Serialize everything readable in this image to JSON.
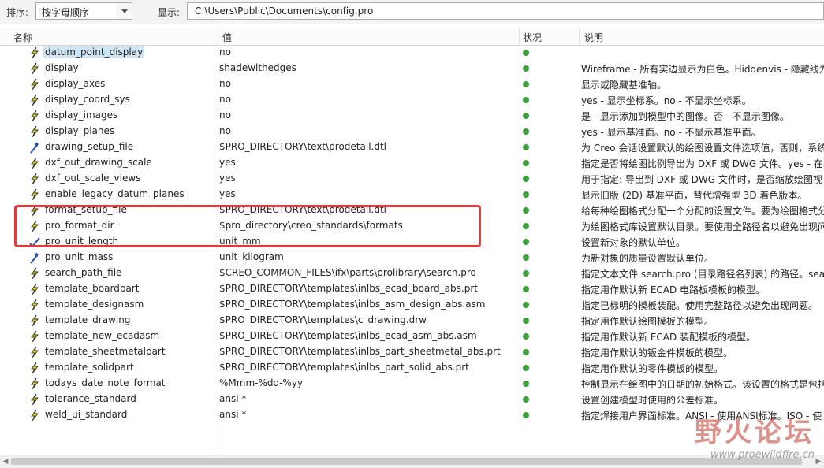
{
  "toolbar": {
    "sort_label": "排序:",
    "sort_value": "按字母顺序",
    "show_label": "显示:",
    "path_value": "C:\\Users\\Public\\Documents\\config.pro"
  },
  "columns": {
    "name": "名称",
    "value": "值",
    "status": "状况",
    "desc": "说明"
  },
  "rows": [
    {
      "name": "datum_point_display",
      "value": "no",
      "desc": "",
      "icon": "lightning-icon"
    },
    {
      "name": "display",
      "value": "shadewithedges",
      "desc": "Wireframe - 所有实边显示为白色。Hiddenvis - 隐藏线为",
      "icon": "lightning-icon"
    },
    {
      "name": "display_axes",
      "value": "no",
      "desc": "显示或隐藏基准轴。",
      "icon": "lightning-icon"
    },
    {
      "name": "display_coord_sys",
      "value": "no",
      "desc": "yes - 显示坐标系。no - 不显示坐标系。",
      "icon": "lightning-icon"
    },
    {
      "name": "display_images",
      "value": "no",
      "desc": "是 - 显示添加到模型中的图像。否 - 不显示图像。",
      "icon": "lightning-icon"
    },
    {
      "name": "display_planes",
      "value": "no",
      "desc": "yes - 显示基准面。no - 不显示基准平面。",
      "icon": "lightning-icon"
    },
    {
      "name": "drawing_setup_file",
      "value": "$PRO_DIRECTORY\\text\\prodetail.dtl",
      "desc": "为 Creo 会话设置默认的绘图设置文件选项值，否则，系统",
      "icon": "wand-icon"
    },
    {
      "name": "dxf_out_drawing_scale",
      "value": "yes",
      "desc": "指定是否将绘图比例导出为 DXF 或 DWG 文件。yes - 在导",
      "icon": "lightning-icon"
    },
    {
      "name": "dxf_out_scale_views",
      "value": "yes",
      "desc": "用于指定: 导出到 DXF 或 DWG 文件时，是否缩放绘图视",
      "icon": "lightning-icon"
    },
    {
      "name": "enable_legacy_datum_planes",
      "value": "yes",
      "desc": "显示旧版 (2D) 基准平面，替代增强型 3D 着色版本。",
      "icon": "lightning-icon"
    },
    {
      "name": "format_setup_file",
      "value": "$PRO_DIRECTORY\\text\\prodetail.dtl",
      "desc": "给每种绘图格式分配一个分配的设置文件。要为绘图格式分",
      "icon": "lightning-icon"
    },
    {
      "name": "pro_format_dir",
      "value": "$pro_directory\\creo_standards\\formats",
      "desc": "为绘图格式库设置默认目录。要使用全路径名以避免出现问",
      "icon": "lightning-icon"
    },
    {
      "name": "pro_unit_length",
      "value": "unit_mm",
      "desc": "设置新对象的默认单位。",
      "icon": "check-icon"
    },
    {
      "name": "pro_unit_mass",
      "value": "unit_kilogram",
      "desc": "为新对象的质量设置默认单位。",
      "icon": "wand-icon"
    },
    {
      "name": "search_path_file",
      "value": "$CREO_COMMON_FILES\\ifx\\parts\\prolibrary\\search.pro",
      "desc": "指定文本文件 search.pro (目录路径名列表) 的路径。sear",
      "icon": "lightning-icon"
    },
    {
      "name": "template_boardpart",
      "value": "$PRO_DIRECTORY\\templates\\inlbs_ecad_board_abs.prt",
      "desc": "指定用作默认新 ECAD 电路板模板的模型。",
      "icon": "lightning-icon"
    },
    {
      "name": "template_designasm",
      "value": "$PRO_DIRECTORY\\templates\\inlbs_asm_design_abs.asm",
      "desc": "指定已标明的模板装配。使用完整路径以避免出现问题。",
      "icon": "lightning-icon"
    },
    {
      "name": "template_drawing",
      "value": "$PRO_DIRECTORY\\templates\\c_drawing.drw",
      "desc": "指定用作默认绘图模板的模型。",
      "icon": "lightning-icon"
    },
    {
      "name": "template_new_ecadasm",
      "value": "$PRO_DIRECTORY\\templates\\inlbs_ecad_asm_abs.asm",
      "desc": "指定用作默认新 ECAD 装配模板的模型。",
      "icon": "lightning-icon"
    },
    {
      "name": "template_sheetmetalpart",
      "value": "$PRO_DIRECTORY\\templates\\inlbs_part_sheetmetal_abs.prt",
      "desc": "指定用作默认的钣金件模板的模型。",
      "icon": "lightning-icon"
    },
    {
      "name": "template_solidpart",
      "value": "$PRO_DIRECTORY\\templates\\inlbs_part_solid_abs.prt",
      "desc": "指定用作默认的零件模板的模型。",
      "icon": "lightning-icon"
    },
    {
      "name": "todays_date_note_format",
      "value": "%Mmm-%dd-%yy",
      "desc": "控制显示在绘图中的日期的初始格式。该设置的格式是包括",
      "icon": "lightning-icon"
    },
    {
      "name": "tolerance_standard",
      "value": "ansi *",
      "desc": "设置创建模型时使用的公差标准。",
      "icon": "lightning-icon"
    },
    {
      "name": "weld_ui_standard",
      "value": "ansi *",
      "desc": "指定焊接用户界面标准。ANSI - 使用ANSI标准。ISO - 使",
      "icon": "lightning-icon"
    }
  ],
  "watermark": {
    "title": "野火论坛",
    "url": "www.proewildfire.cn"
  },
  "colors": {
    "status": "#3f9e3f",
    "selection": "#cde6f7",
    "highlight": "#e23b3b"
  }
}
